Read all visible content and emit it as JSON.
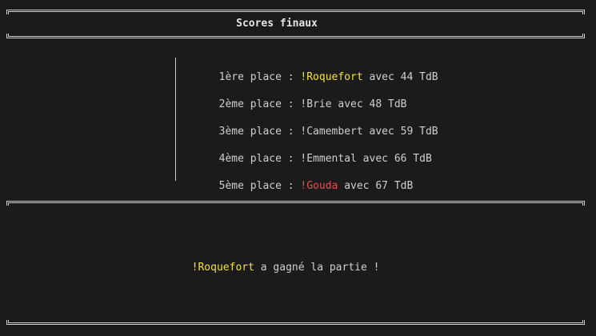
{
  "title": "Scores finaux",
  "colors": {
    "background": "#1b1b1b",
    "text": "#cfcfcf",
    "winner": "#f2e24a",
    "loser": "#e05252"
  },
  "scores": [
    {
      "place": "1ère place : ",
      "name": "!Roquefort",
      "rest": " avec 44 TdB",
      "highlight": "winner"
    },
    {
      "place": "2ème place : ",
      "name": "!Brie",
      "rest": " avec 48 TdB",
      "highlight": "none"
    },
    {
      "place": "3ème place : ",
      "name": "!Camembert",
      "rest": " avec 59 TdB",
      "highlight": "none"
    },
    {
      "place": "4ème place : ",
      "name": "!Emmental",
      "rest": " avec 66 TdB",
      "highlight": "none"
    },
    {
      "place": "5ème place : ",
      "name": "!Gouda",
      "rest": " avec 67 TdB",
      "highlight": "loser"
    }
  ],
  "result": {
    "winner_name": "!Roquefort",
    "message": " a gagné la partie !"
  }
}
